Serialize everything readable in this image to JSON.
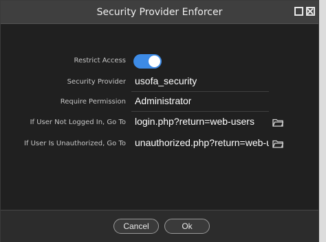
{
  "window": {
    "title": "Security Provider Enforcer"
  },
  "form": {
    "restrict_access_label": "Restrict Access",
    "restrict_access_on": true,
    "security_provider_label": "Security Provider",
    "security_provider_value": "usofa_security",
    "require_permission_label": "Require Permission",
    "require_permission_value": "Administrator",
    "not_logged_in_label": "If User Not Logged In, Go To",
    "not_logged_in_value": "login.php?return=web-users",
    "unauthorized_label": "If User Is Unauthorized, Go To",
    "unauthorized_value": "unauthorized.php?return=web-us"
  },
  "buttons": {
    "cancel": "Cancel",
    "ok": "Ok"
  },
  "colors": {
    "accent": "#3d8be6"
  },
  "icons": [
    "maximize-icon",
    "close-icon",
    "folder-icon"
  ]
}
